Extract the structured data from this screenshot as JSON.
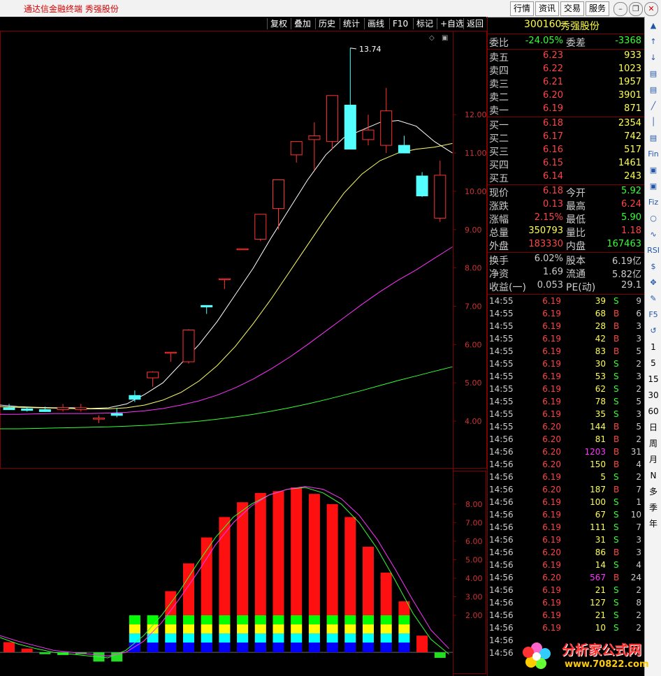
{
  "app": {
    "title": "通达信金融终端  秀强股份",
    "menu": [
      "行情",
      "资讯",
      "交易",
      "服务"
    ]
  },
  "toolbar": [
    "复权",
    "叠加",
    "历史",
    "统计",
    "画线",
    "F10",
    "标记",
    "+自选",
    "返回"
  ],
  "stock": {
    "code": "300160",
    "name": "秀强股份"
  },
  "chart_data": [
    {
      "type": "candlestick",
      "title": "",
      "high_label": "13.74",
      "y_ticks": [
        "12.00",
        "11.00",
        "10.00",
        "9.00",
        "8.00",
        "7.00",
        "6.00",
        "5.00",
        "4.00"
      ],
      "ylim": [
        3.6,
        13.9
      ],
      "candles": [
        {
          "o": 4.35,
          "h": 4.45,
          "l": 4.3,
          "c": 4.3
        },
        {
          "o": 4.32,
          "h": 4.38,
          "l": 4.25,
          "c": 4.28
        },
        {
          "o": 4.3,
          "h": 4.38,
          "l": 4.25,
          "c": 4.25
        },
        {
          "o": 4.3,
          "h": 4.45,
          "l": 4.25,
          "c": 4.35
        },
        {
          "o": 4.3,
          "h": 4.45,
          "l": 4.25,
          "c": 4.35
        },
        {
          "o": 4.08,
          "h": 4.15,
          "l": 3.95,
          "c": 4.08
        },
        {
          "o": 4.2,
          "h": 4.35,
          "l": 4.1,
          "c": 4.15
        },
        {
          "o": 4.67,
          "h": 4.8,
          "l": 4.5,
          "c": 4.57
        },
        {
          "o": 5.13,
          "h": 5.3,
          "l": 4.9,
          "c": 5.28
        },
        {
          "o": 5.8,
          "h": 5.8,
          "l": 5.55,
          "c": 5.8
        },
        {
          "o": 5.55,
          "h": 6.4,
          "l": 5.5,
          "c": 6.38
        },
        {
          "o": 7.02,
          "h": 7.02,
          "l": 6.8,
          "c": 6.98
        },
        {
          "o": 7.72,
          "h": 7.72,
          "l": 7.45,
          "c": 7.72
        },
        {
          "o": 8.5,
          "h": 8.5,
          "l": 8.5,
          "c": 8.5
        },
        {
          "o": 8.75,
          "h": 9.4,
          "l": 8.7,
          "c": 9.4
        },
        {
          "o": 9.55,
          "h": 10.3,
          "l": 9.0,
          "c": 10.3
        },
        {
          "o": 10.95,
          "h": 11.3,
          "l": 10.75,
          "c": 11.3
        },
        {
          "o": 11.35,
          "h": 11.8,
          "l": 10.55,
          "c": 11.45
        },
        {
          "o": 11.3,
          "h": 12.5,
          "l": 11.1,
          "c": 12.5
        },
        {
          "o": 12.25,
          "h": 13.74,
          "l": 11.7,
          "c": 11.1
        },
        {
          "o": 11.35,
          "h": 12.0,
          "l": 11.2,
          "c": 11.6
        },
        {
          "o": 11.2,
          "h": 12.7,
          "l": 11.0,
          "c": 12.1
        },
        {
          "o": 11.2,
          "h": 11.45,
          "l": 11.0,
          "c": 11.0
        },
        {
          "o": 10.4,
          "h": 10.5,
          "l": 9.85,
          "c": 9.88
        },
        {
          "o": 9.3,
          "h": 10.8,
          "l": 9.2,
          "c": 10.42
        }
      ],
      "ma_lines": [
        {
          "color": "#ffffff",
          "values": [
            4.42,
            4.38,
            4.36,
            4.35,
            4.35,
            4.33,
            4.35,
            4.45,
            4.7,
            5.0,
            5.5,
            6.0,
            6.6,
            7.3,
            8.0,
            8.8,
            9.55,
            10.3,
            10.95,
            11.4,
            11.6,
            11.8,
            11.85,
            11.7,
            11.3,
            11.0
          ]
        },
        {
          "color": "#ffff66",
          "values": [
            4.38,
            4.36,
            4.35,
            4.34,
            4.33,
            4.32,
            4.32,
            4.35,
            4.42,
            4.55,
            4.75,
            5.05,
            5.45,
            5.95,
            6.55,
            7.2,
            7.9,
            8.6,
            9.3,
            9.95,
            10.45,
            10.8,
            11.0,
            11.1,
            11.15,
            11.25
          ]
        },
        {
          "color": "#ff33ff",
          "values": [
            4.18,
            4.18,
            4.19,
            4.2,
            4.2,
            4.2,
            4.21,
            4.23,
            4.27,
            4.33,
            4.42,
            4.53,
            4.68,
            4.87,
            5.1,
            5.37,
            5.67,
            6.0,
            6.35,
            6.7,
            7.05,
            7.38,
            7.68,
            7.95,
            8.25,
            8.55
          ]
        },
        {
          "color": "#33ff33",
          "values": [
            3.8,
            3.8,
            3.81,
            3.82,
            3.83,
            3.84,
            3.85,
            3.87,
            3.89,
            3.92,
            3.96,
            4.0,
            4.05,
            4.11,
            4.18,
            4.26,
            4.35,
            4.45,
            4.56,
            4.68,
            4.8,
            4.93,
            5.06,
            5.18,
            5.3,
            5.42
          ]
        }
      ]
    },
    {
      "type": "bar",
      "title": "",
      "y_ticks": [
        "8.00",
        "7.00",
        "6.00",
        "5.00",
        "4.00",
        "3.00",
        "2.00"
      ],
      "ylim": [
        -0.6,
        9.2
      ],
      "values": [
        0.55,
        0.2,
        -0.1,
        -0.15,
        -0.1,
        -0.5,
        -0.5,
        1.5,
        1.7,
        3.3,
        4.8,
        6.2,
        7.3,
        8.1,
        8.6,
        8.7,
        8.9,
        8.55,
        8.0,
        7.3,
        5.7,
        4.3,
        2.75,
        0.9,
        -0.3
      ],
      "line1": [
        0.8,
        0.45,
        0.2,
        0.0,
        -0.1,
        -0.2,
        -0.3,
        0.1,
        0.9,
        2.0,
        3.3,
        4.8,
        6.2,
        7.3,
        8.0,
        8.5,
        8.8,
        8.9,
        8.6,
        8.0,
        7.0,
        5.6,
        3.9,
        2.1,
        0.7,
        -0.1
      ],
      "line2": [
        0.9,
        0.6,
        0.35,
        0.1,
        0.0,
        -0.1,
        -0.2,
        0.0,
        0.6,
        1.6,
        2.9,
        4.3,
        5.8,
        7.0,
        7.9,
        8.5,
        8.8,
        8.95,
        8.8,
        8.3,
        7.4,
        6.1,
        4.5,
        2.8,
        1.2,
        0.2
      ]
    }
  ],
  "quote": {
    "weibi_label": "委比",
    "weibi": "-24.05%",
    "weicha_label": "委差",
    "weicha": "-3368",
    "asks": [
      {
        "label": "卖五",
        "price": "6.23",
        "vol": "933"
      },
      {
        "label": "卖四",
        "price": "6.22",
        "vol": "1023"
      },
      {
        "label": "卖三",
        "price": "6.21",
        "vol": "1957"
      },
      {
        "label": "卖二",
        "price": "6.20",
        "vol": "3901"
      },
      {
        "label": "卖一",
        "price": "6.19",
        "vol": "871"
      }
    ],
    "bids": [
      {
        "label": "买一",
        "price": "6.18",
        "vol": "2354"
      },
      {
        "label": "买二",
        "price": "6.17",
        "vol": "742"
      },
      {
        "label": "买三",
        "price": "6.16",
        "vol": "517"
      },
      {
        "label": "买四",
        "price": "6.15",
        "vol": "1461"
      },
      {
        "label": "买五",
        "price": "6.14",
        "vol": "243"
      }
    ],
    "stats": [
      {
        "l1": "现价",
        "v1": "6.18",
        "c1": "#ff4444",
        "l2": "今开",
        "v2": "5.92",
        "c2": "#33ff33"
      },
      {
        "l1": "涨跌",
        "v1": "0.13",
        "c1": "#ff4444",
        "l2": "最高",
        "v2": "6.24",
        "c2": "#ff4444"
      },
      {
        "l1": "涨幅",
        "v1": "2.15%",
        "c1": "#ff4444",
        "l2": "最低",
        "v2": "5.90",
        "c2": "#33ff33"
      },
      {
        "l1": "总量",
        "v1": "350793",
        "c1": "#ffff55",
        "l2": "量比",
        "v2": "1.18",
        "c2": "#ff4444"
      },
      {
        "l1": "外盘",
        "v1": "183330",
        "c1": "#ff4444",
        "l2": "内盘",
        "v2": "167463",
        "c2": "#33ff33"
      }
    ],
    "info": [
      {
        "l1": "换手",
        "v1": "6.02%",
        "l2": "股本",
        "v2": "6.19亿"
      },
      {
        "l1": "净资",
        "v1": "1.69",
        "l2": "流通",
        "v2": "5.82亿"
      },
      {
        "l1": "收益(一)",
        "v1": "0.053",
        "l2": "PE(动)",
        "v2": "29.1"
      }
    ]
  },
  "ticks": [
    [
      "14:55",
      "6.19",
      "39",
      "S",
      "9"
    ],
    [
      "14:55",
      "6.19",
      "68",
      "B",
      "6"
    ],
    [
      "14:55",
      "6.19",
      "28",
      "B",
      "3"
    ],
    [
      "14:55",
      "6.19",
      "42",
      "B",
      "3"
    ],
    [
      "14:55",
      "6.19",
      "83",
      "B",
      "5"
    ],
    [
      "14:55",
      "6.19",
      "30",
      "S",
      "2"
    ],
    [
      "14:55",
      "6.19",
      "53",
      "S",
      "3"
    ],
    [
      "14:55",
      "6.19",
      "62",
      "S",
      "2"
    ],
    [
      "14:55",
      "6.19",
      "78",
      "S",
      "5"
    ],
    [
      "14:55",
      "6.19",
      "35",
      "S",
      "3"
    ],
    [
      "14:55",
      "6.20",
      "144",
      "B",
      "5"
    ],
    [
      "14:56",
      "6.20",
      "81",
      "B",
      "2"
    ],
    [
      "14:56",
      "6.20",
      "1203",
      "B",
      "31"
    ],
    [
      "14:56",
      "6.20",
      "150",
      "B",
      "4"
    ],
    [
      "14:56",
      "6.19",
      "5",
      "S",
      "2"
    ],
    [
      "14:56",
      "6.20",
      "187",
      "B",
      "7"
    ],
    [
      "14:56",
      "6.19",
      "100",
      "S",
      "1"
    ],
    [
      "14:56",
      "6.19",
      "67",
      "S",
      "10"
    ],
    [
      "14:56",
      "6.19",
      "111",
      "S",
      "7"
    ],
    [
      "14:56",
      "6.19",
      "31",
      "S",
      "3"
    ],
    [
      "14:56",
      "6.20",
      "86",
      "B",
      "3"
    ],
    [
      "14:56",
      "6.19",
      "14",
      "S",
      "4"
    ],
    [
      "14:56",
      "6.20",
      "567",
      "B",
      "24"
    ],
    [
      "14:56",
      "6.19",
      "21",
      "S",
      "2"
    ],
    [
      "14:56",
      "6.19",
      "127",
      "S",
      "8"
    ],
    [
      "14:56",
      "6.19",
      "21",
      "S",
      "2"
    ],
    [
      "14:56",
      "6.19",
      "10",
      "S",
      "2"
    ],
    [
      "14:56",
      "",
      "",
      " ",
      ""
    ],
    [
      "14:56",
      "",
      "",
      " ",
      ""
    ]
  ],
  "side_icons": [
    "▲",
    "↑",
    "↓",
    "▤",
    "▤",
    "╱",
    "│",
    "▤",
    "Fin",
    "▣",
    "▣",
    "Fiz",
    "○",
    "∿",
    "RSI",
    "$",
    "✥",
    "✎",
    "F5",
    "↺",
    "1",
    "5",
    "15",
    "30",
    "60",
    "日",
    "周",
    "月",
    "N",
    "多",
    "季",
    "年"
  ],
  "watermark": {
    "text": "分析家公式网",
    "url": "www.70822.com"
  }
}
